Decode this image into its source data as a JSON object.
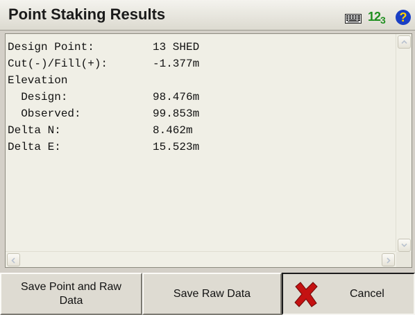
{
  "window": {
    "title": "Point Staking Results",
    "icons": [
      "keyboard-icon",
      "numeric-input-icon",
      "help-icon"
    ],
    "numeric_indicator": {
      "main": "12",
      "sub": "3"
    },
    "help_glyph": "?"
  },
  "results": {
    "lines": [
      {
        "label": "Design Point:",
        "value": "13 SHED"
      },
      {
        "label": "Cut(-)/Fill(+):",
        "value": "-1.377m"
      },
      {
        "label": "Elevation",
        "value": ""
      },
      {
        "label": "  Design:",
        "value": "98.476m"
      },
      {
        "label": "  Observed:",
        "value": "99.853m"
      },
      {
        "label": "Delta N:",
        "value": "8.462m"
      },
      {
        "label": "Delta E:",
        "value": "15.523m"
      }
    ]
  },
  "buttons": {
    "save_point_line1": "Save Point and Raw",
    "save_point_line2": "Data",
    "save_raw": "Save Raw Data",
    "cancel": "Cancel"
  },
  "colors": {
    "cancel_icon": "#c41212",
    "numeric_indicator": "#1f8f1f",
    "help_icon_bg": "#1a3fc4"
  }
}
